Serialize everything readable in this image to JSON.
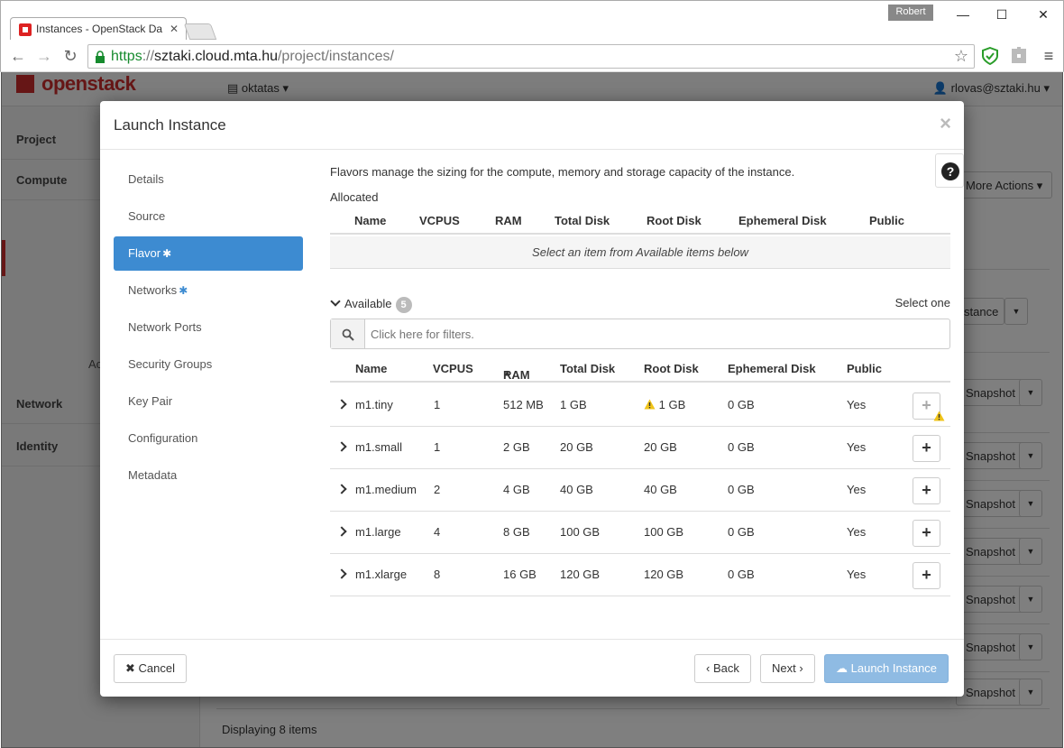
{
  "browser": {
    "tab_title": "Instances - OpenStack Da",
    "profile_name": "Robert",
    "url_scheme": "https",
    "url_sep": "://",
    "url_host": "sztaki.cloud.mta.hu",
    "url_path": "/project/instances/"
  },
  "topbar": {
    "logo": "openstack",
    "project": "oktatas",
    "user": "rlovas@sztaki.hu"
  },
  "sidebar": {
    "items": [
      "Project",
      "Compute",
      "Network",
      "Identity"
    ],
    "partial_text": "Ac"
  },
  "background": {
    "more_actions": "More Actions",
    "launch_partial": "stance",
    "snapshot": "Snapshot",
    "displaying": "Displaying 8 items"
  },
  "modal": {
    "title": "Launch Instance",
    "close": "×",
    "nav": [
      {
        "label": "Details",
        "required": false
      },
      {
        "label": "Source",
        "required": false
      },
      {
        "label": "Flavor",
        "required": true
      },
      {
        "label": "Networks",
        "required": true
      },
      {
        "label": "Network Ports",
        "required": false
      },
      {
        "label": "Security Groups",
        "required": false
      },
      {
        "label": "Key Pair",
        "required": false
      },
      {
        "label": "Configuration",
        "required": false
      },
      {
        "label": "Metadata",
        "required": false
      }
    ],
    "active_nav": "Flavor",
    "flavor": {
      "description": "Flavors manage the sizing for the compute, memory and storage capacity of the instance.",
      "allocated_label": "Allocated",
      "allocated_columns": [
        "Name",
        "VCPUS",
        "RAM",
        "Total Disk",
        "Root Disk",
        "Ephemeral Disk",
        "Public"
      ],
      "allocated_empty": "Select an item from Available items below",
      "available_label": "Available",
      "available_count": "5",
      "select_hint": "Select one",
      "search_placeholder": "Click here for filters.",
      "available_columns": [
        "Name",
        "VCPUS",
        "RAM",
        "Total Disk",
        "Root Disk",
        "Ephemeral Disk",
        "Public"
      ],
      "sorted_column": "RAM",
      "rows": [
        {
          "name": "m1.tiny",
          "vcpus": "1",
          "ram": "512 MB",
          "total_disk": "1 GB",
          "root_disk": "1 GB",
          "ephemeral": "0 GB",
          "public": "Yes",
          "warning": true
        },
        {
          "name": "m1.small",
          "vcpus": "1",
          "ram": "2 GB",
          "total_disk": "20 GB",
          "root_disk": "20 GB",
          "ephemeral": "0 GB",
          "public": "Yes",
          "warning": false
        },
        {
          "name": "m1.medium",
          "vcpus": "2",
          "ram": "4 GB",
          "total_disk": "40 GB",
          "root_disk": "40 GB",
          "ephemeral": "0 GB",
          "public": "Yes",
          "warning": false
        },
        {
          "name": "m1.large",
          "vcpus": "4",
          "ram": "8 GB",
          "total_disk": "100 GB",
          "root_disk": "100 GB",
          "ephemeral": "0 GB",
          "public": "Yes",
          "warning": false
        },
        {
          "name": "m1.xlarge",
          "vcpus": "8",
          "ram": "16 GB",
          "total_disk": "120 GB",
          "root_disk": "120 GB",
          "ephemeral": "0 GB",
          "public": "Yes",
          "warning": false
        }
      ]
    },
    "footer": {
      "cancel": "Cancel",
      "back": "Back",
      "next": "Next",
      "launch": "Launch Instance"
    }
  },
  "colors": {
    "accent": "#3d8bd1",
    "primary_disabled": "#8fbbe3",
    "warning": "#f0c419",
    "brand": "#cd2d2d"
  },
  "icons": [
    "lock-icon",
    "star-icon",
    "shield-icon",
    "puzzle-icon",
    "menu-icon",
    "help-icon",
    "search-icon",
    "warning-icon",
    "plus-icon",
    "cloud-upload-icon",
    "times-icon"
  ]
}
